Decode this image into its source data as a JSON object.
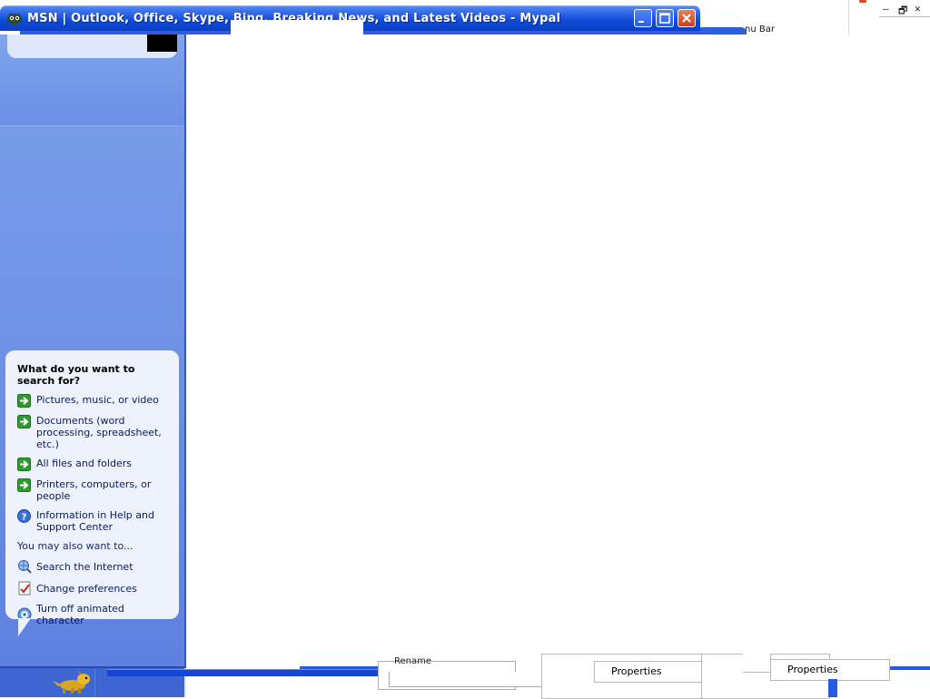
{
  "window": {
    "title": "MSN | Outlook, Office, Skype, Bing, Breaking News, and Latest Videos - Mypal",
    "buttons": {
      "minimize": "minimize",
      "maximize": "maximize",
      "close": "close"
    }
  },
  "background": {
    "menu_bar_fragment": "nu Bar",
    "top_right_controls": {
      "minimize": "–",
      "restore": "🗗",
      "close": "✕"
    }
  },
  "search_companion": {
    "question": "What do you want to search for?",
    "options": [
      {
        "label": "Pictures, music, or video",
        "icon": "green-arrow-icon"
      },
      {
        "label": "Documents (word processing, spreadsheet, etc.)",
        "icon": "green-arrow-icon"
      },
      {
        "label": "All files and folders",
        "icon": "green-arrow-icon"
      },
      {
        "label": "Printers, computers, or people",
        "icon": "green-arrow-icon"
      },
      {
        "label": "Information in Help and Support Center",
        "icon": "help-icon"
      }
    ],
    "also_heading": "You may also want to...",
    "also_options": [
      {
        "label": "Search the Internet",
        "icon": "internet-search-icon"
      },
      {
        "label": "Change preferences",
        "icon": "preferences-icon"
      },
      {
        "label": "Turn off animated character",
        "icon": "animated-character-icon"
      }
    ]
  },
  "bottom_fragments": {
    "properties_1": "Properties",
    "properties_2": "Properties",
    "clipped_text": "Rename"
  },
  "colors": {
    "title_bar": "#0f49d6",
    "pane": "#6f92e6",
    "bubble": "#eef2fc",
    "close_button": "#c8401a"
  }
}
